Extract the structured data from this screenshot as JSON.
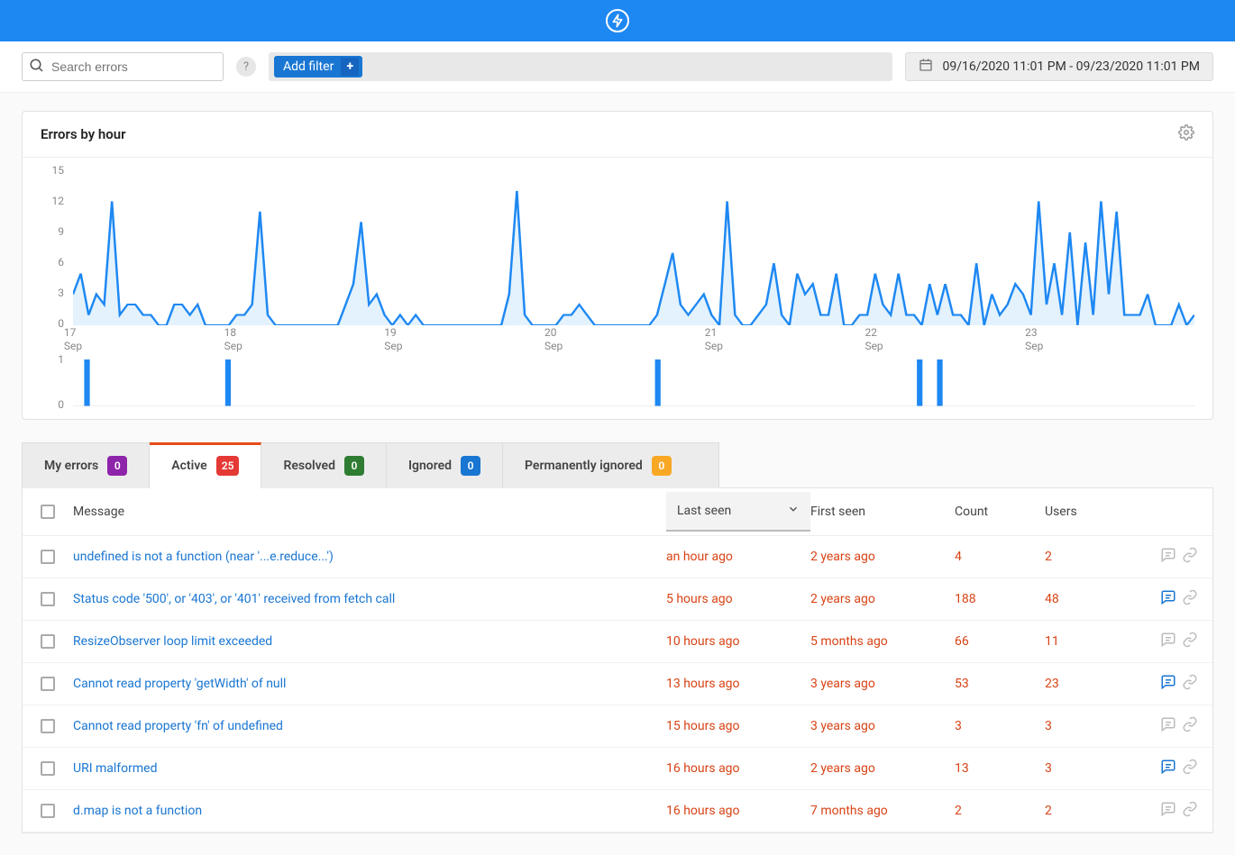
{
  "topbar": {
    "logo_name": "bolt-logo"
  },
  "toolbar": {
    "search_placeholder": "Search errors",
    "help_label": "?",
    "add_filter_label": "Add filter",
    "plus_label": "+",
    "date_range_text": "09/16/2020 11:01 PM - 09/23/2020 11:01 PM"
  },
  "panel": {
    "title": "Errors by hour"
  },
  "chart_data": {
    "type": "area",
    "title": "Errors by hour",
    "xlabel": "",
    "ylabel": "",
    "ylim": [
      0,
      15
    ],
    "y_ticks": [
      0,
      3,
      6,
      9,
      12,
      15
    ],
    "x_tick_labels": [
      {
        "top": "17",
        "sub": "Sep"
      },
      {
        "top": "18",
        "sub": "Sep"
      },
      {
        "top": "19",
        "sub": "Sep"
      },
      {
        "top": "20",
        "sub": "Sep"
      },
      {
        "top": "21",
        "sub": "Sep"
      },
      {
        "top": "22",
        "sub": "Sep"
      },
      {
        "top": "23",
        "sub": "Sep"
      }
    ],
    "x": [
      0,
      1,
      2,
      3,
      4,
      5,
      6,
      7,
      8,
      9,
      10,
      11,
      12,
      13,
      14,
      15,
      16,
      17,
      18,
      19,
      20,
      21,
      22,
      23,
      24,
      25,
      26,
      27,
      28,
      29,
      30,
      31,
      32,
      33,
      34,
      35,
      36,
      37,
      38,
      39,
      40,
      41,
      42,
      43,
      44,
      45,
      46,
      47,
      48,
      49,
      50,
      51,
      52,
      53,
      54,
      55,
      56,
      57,
      58,
      59,
      60,
      61,
      62,
      63,
      64,
      65,
      66,
      67,
      68,
      69,
      70,
      71,
      72,
      73,
      74,
      75,
      76,
      77,
      78,
      79,
      80,
      81,
      82,
      83,
      84,
      85,
      86,
      87,
      88,
      89,
      90,
      91,
      92,
      93,
      94,
      95,
      96,
      97,
      98,
      99,
      100,
      101,
      102,
      103,
      104,
      105,
      106,
      107,
      108,
      109,
      110,
      111,
      112,
      113,
      114,
      115,
      116,
      117,
      118,
      119,
      120,
      121,
      122,
      123,
      124,
      125,
      126,
      127,
      128,
      129,
      130,
      131,
      132,
      133,
      134,
      135,
      136,
      137,
      138,
      139,
      140,
      141,
      142,
      143,
      144,
      145,
      146,
      147,
      148,
      149,
      150,
      151,
      152,
      153,
      154,
      155,
      156,
      157,
      158,
      159,
      160,
      161,
      162,
      163,
      164,
      165,
      166,
      167
    ],
    "values": [
      3,
      5,
      1,
      3,
      2,
      12,
      1,
      2,
      2,
      1,
      1,
      0,
      0,
      2,
      2,
      1,
      2,
      0,
      0,
      0,
      0,
      1,
      1,
      2,
      11,
      1,
      0,
      0,
      0,
      0,
      0,
      0,
      0,
      0,
      0,
      2,
      4,
      10,
      2,
      3,
      1,
      0,
      1,
      0,
      1,
      0,
      0,
      0,
      0,
      0,
      0,
      0,
      0,
      0,
      0,
      0,
      3,
      13,
      1,
      0,
      0,
      0,
      0,
      1,
      1,
      2,
      1,
      0,
      0,
      0,
      0,
      0,
      0,
      0,
      0,
      1,
      4,
      7,
      2,
      1,
      2,
      3,
      1,
      0,
      12,
      1,
      0,
      0,
      1,
      2,
      6,
      1,
      0,
      5,
      3,
      4,
      1,
      1,
      5,
      0,
      0,
      1,
      1,
      5,
      2,
      1,
      5,
      1,
      1,
      0,
      4,
      1,
      4,
      1,
      1,
      0,
      6,
      0,
      3,
      1,
      2,
      4,
      3,
      1,
      12,
      2,
      6,
      1,
      9,
      0,
      8,
      1,
      12,
      3,
      11,
      1,
      1,
      1,
      3,
      0,
      0,
      0,
      2,
      0,
      1
    ],
    "secondary_chart": {
      "type": "bar",
      "ylim": [
        0,
        1
      ],
      "y_ticks": [
        0,
        1
      ],
      "indices_with_value_1": [
        2,
        23,
        87,
        126,
        129
      ]
    }
  },
  "tabs": [
    {
      "key": "my_errors",
      "label": "My errors",
      "badge": "0",
      "color": "purple"
    },
    {
      "key": "active",
      "label": "Active",
      "badge": "25",
      "color": "red"
    },
    {
      "key": "resolved",
      "label": "Resolved",
      "badge": "0",
      "color": "green"
    },
    {
      "key": "ignored",
      "label": "Ignored",
      "badge": "0",
      "color": "blue"
    },
    {
      "key": "perm_ignored",
      "label": "Permanently ignored",
      "badge": "0",
      "color": "orange"
    }
  ],
  "active_tab": "active",
  "table": {
    "columns": {
      "message": "Message",
      "last_seen": "Last seen",
      "first_seen": "First seen",
      "count": "Count",
      "users": "Users"
    },
    "rows": [
      {
        "message": "undefined is not a function (near '...e.reduce...')",
        "last_seen": "an hour ago",
        "first_seen": "2 years ago",
        "count": "4",
        "users": "2",
        "has_comment": false
      },
      {
        "message": "Status code '500', or '403', or '401' received from fetch call",
        "last_seen": "5 hours ago",
        "first_seen": "2 years ago",
        "count": "188",
        "users": "48",
        "has_comment": true
      },
      {
        "message": "ResizeObserver loop limit exceeded",
        "last_seen": "10 hours ago",
        "first_seen": "5 months ago",
        "count": "66",
        "users": "11",
        "has_comment": false
      },
      {
        "message": "Cannot read property 'getWidth' of null",
        "last_seen": "13 hours ago",
        "first_seen": "3 years ago",
        "count": "53",
        "users": "23",
        "has_comment": true
      },
      {
        "message": "Cannot read property 'fn' of undefined",
        "last_seen": "15 hours ago",
        "first_seen": "3 years ago",
        "count": "3",
        "users": "3",
        "has_comment": false
      },
      {
        "message": "URI malformed",
        "last_seen": "16 hours ago",
        "first_seen": "2 years ago",
        "count": "13",
        "users": "3",
        "has_comment": true
      },
      {
        "message": "d.map is not a function",
        "last_seen": "16 hours ago",
        "first_seen": "7 months ago",
        "count": "2",
        "users": "2",
        "has_comment": false
      }
    ]
  }
}
